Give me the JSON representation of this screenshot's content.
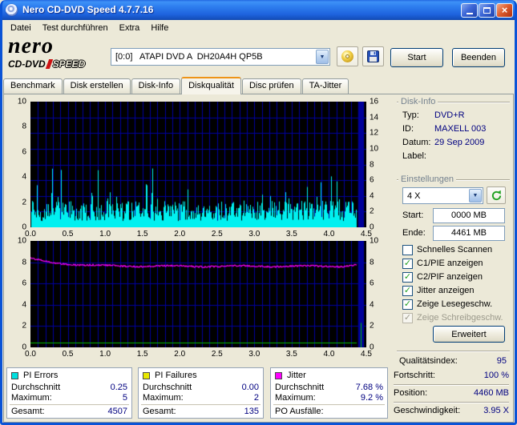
{
  "window": {
    "title": "Nero CD-DVD Speed 4.7.7.16"
  },
  "menu": {
    "items": [
      "Datei",
      "Test durchführen",
      "Extra",
      "Hilfe"
    ]
  },
  "logo": {
    "brand": "nero",
    "product1": "CD-DVD",
    "product2": "SPEED"
  },
  "toolbar": {
    "drive": "[0:0]   ATAPI DVD A  DH20A4H QP5B",
    "start_label": "Start",
    "quit_label": "Beenden"
  },
  "icons": {
    "titlebar": [
      "minimize-icon",
      "maximize-icon",
      "close-icon"
    ],
    "app": "cd-disc-icon",
    "eject": "eject-disc-icon",
    "save": "save-floppy-icon",
    "dropdown": "dropdown-arrow-icon",
    "refresh": "refresh-speed-icon"
  },
  "tabs": [
    {
      "label": "Benchmark",
      "active": false
    },
    {
      "label": "Disk erstellen",
      "active": false
    },
    {
      "label": "Disk-Info",
      "active": false
    },
    {
      "label": "Diskqualität",
      "active": true
    },
    {
      "label": "Disc prüfen",
      "active": false
    },
    {
      "label": "TA-Jitter",
      "active": false
    }
  ],
  "disk_info": {
    "caption": "Disk-Info",
    "rows": [
      {
        "label": "Typ:",
        "value": "DVD+R"
      },
      {
        "label": "ID:",
        "value": "MAXELL 003"
      },
      {
        "label": "Datum:",
        "value": "29 Sep 2009"
      },
      {
        "label": "Label:",
        "value": ""
      }
    ]
  },
  "settings": {
    "caption": "Einstellungen",
    "speed": "4 X",
    "start_label": "Start:",
    "start_value": "0000 MB",
    "end_label": "Ende:",
    "end_value": "4461 MB",
    "checkboxes": [
      {
        "label": "Schnelles Scannen",
        "checked": false,
        "disabled": false
      },
      {
        "label": "C1/PIE anzeigen",
        "checked": true,
        "disabled": false
      },
      {
        "label": "C2/PIF anzeigen",
        "checked": true,
        "disabled": false
      },
      {
        "label": "Jitter anzeigen",
        "checked": true,
        "disabled": false
      },
      {
        "label": "Zeige Lesegeschw.",
        "checked": true,
        "disabled": false
      },
      {
        "label": "Zeige Schreibgeschw.",
        "checked": true,
        "disabled": true
      }
    ],
    "advanced_label": "Erweitert"
  },
  "quality": {
    "label": "Qualitätsindex:",
    "value": "95"
  },
  "stats_panels": [
    {
      "title": "PI Errors",
      "color": "#00E0E0",
      "rows": [
        [
          "Durchschnitt",
          "0.25"
        ],
        [
          "Maximum:",
          "5"
        ]
      ],
      "footer": [
        "Gesamt:",
        "4507"
      ]
    },
    {
      "title": "PI Failures",
      "color": "#E8E800",
      "rows": [
        [
          "Durchschnitt",
          "0.00"
        ],
        [
          "Maximum:",
          "2"
        ]
      ],
      "footer": [
        "Gesamt:",
        "135"
      ]
    },
    {
      "title": "Jitter",
      "color": "#FF00FF",
      "rows": [
        [
          "Durchschnitt",
          "7.68 %"
        ],
        [
          "Maximum:",
          "9.2 %"
        ]
      ],
      "footer": [
        "PO Ausfälle:",
        ""
      ]
    }
  ],
  "progress_panel": {
    "rows": [
      [
        "Fortschritt:",
        "100 %"
      ],
      [
        "Position:",
        "4460 MB"
      ],
      [
        "Geschwindigkeit:",
        "3.95 X"
      ]
    ]
  },
  "colors": {
    "window_bg": "#ECE9D8",
    "chart_bg": "#000000",
    "grid_blue": "#0000A0",
    "value_text": "#000080",
    "pie_cyan": "#00F0F0",
    "jitter_magenta": "#FF00FF",
    "speed_green": "#00BB00"
  },
  "chart_data": [
    {
      "type": "bar",
      "name": "pi-errors-scan",
      "seed": 9301,
      "x_range": [
        0,
        4.5
      ],
      "x_ticks": [
        "0.0",
        "0.5",
        "1.0",
        "1.5",
        "2.0",
        "2.5",
        "3.0",
        "3.5",
        "4.0",
        "4.5"
      ],
      "y_left_range": [
        0,
        10
      ],
      "y_left_ticks": [
        "10",
        "8",
        "6",
        "4",
        "2",
        "0"
      ],
      "y_right_range": [
        0,
        16
      ],
      "y_right_ticks": [
        "16",
        "14",
        "12",
        "10",
        "8",
        "6",
        "4",
        "2",
        "0"
      ],
      "grid": {
        "color": "#0000A0",
        "v_step": 0.1,
        "h_div": 8
      },
      "series": [
        {
          "name": "PI Errors",
          "color": "#00F0F0",
          "average": 0.25,
          "maximum": 5,
          "total": 4507
        }
      ],
      "data_end_x": 4.38,
      "end_block": {
        "color": "#000099",
        "x0": 4.39,
        "x1": 4.47
      }
    },
    {
      "type": "line",
      "name": "jitter-scan",
      "seed": 4721,
      "x_range": [
        0,
        4.5
      ],
      "x_ticks": [
        "0.0",
        "0.5",
        "1.0",
        "1.5",
        "2.0",
        "2.5",
        "3.0",
        "3.5",
        "4.0",
        "4.5"
      ],
      "y_left_range": [
        0,
        10
      ],
      "y_left_ticks": [
        "10",
        "8",
        "6",
        "4",
        "2",
        "0"
      ],
      "y_right_range": [
        0,
        10
      ],
      "y_right_ticks": [
        "10",
        "8",
        "6",
        "4",
        "2",
        "0"
      ],
      "grid": {
        "color": "#0000A0",
        "v_step": 0.1,
        "h_div": 5
      },
      "series": [
        {
          "name": "Jitter",
          "color": "#FF00FF",
          "average": 7.68,
          "maximum": 9.2,
          "start": 8.35,
          "settle": 7.62
        },
        {
          "name": "Lesegeschwindigkeit",
          "color": "#00BB00",
          "level": 0.45,
          "end_spike": 2.3,
          "end_spike_x": 4.43
        }
      ],
      "data_end_x": 4.38,
      "end_block": {
        "color": "#000099",
        "x0": 4.39,
        "x1": 4.47
      }
    }
  ]
}
